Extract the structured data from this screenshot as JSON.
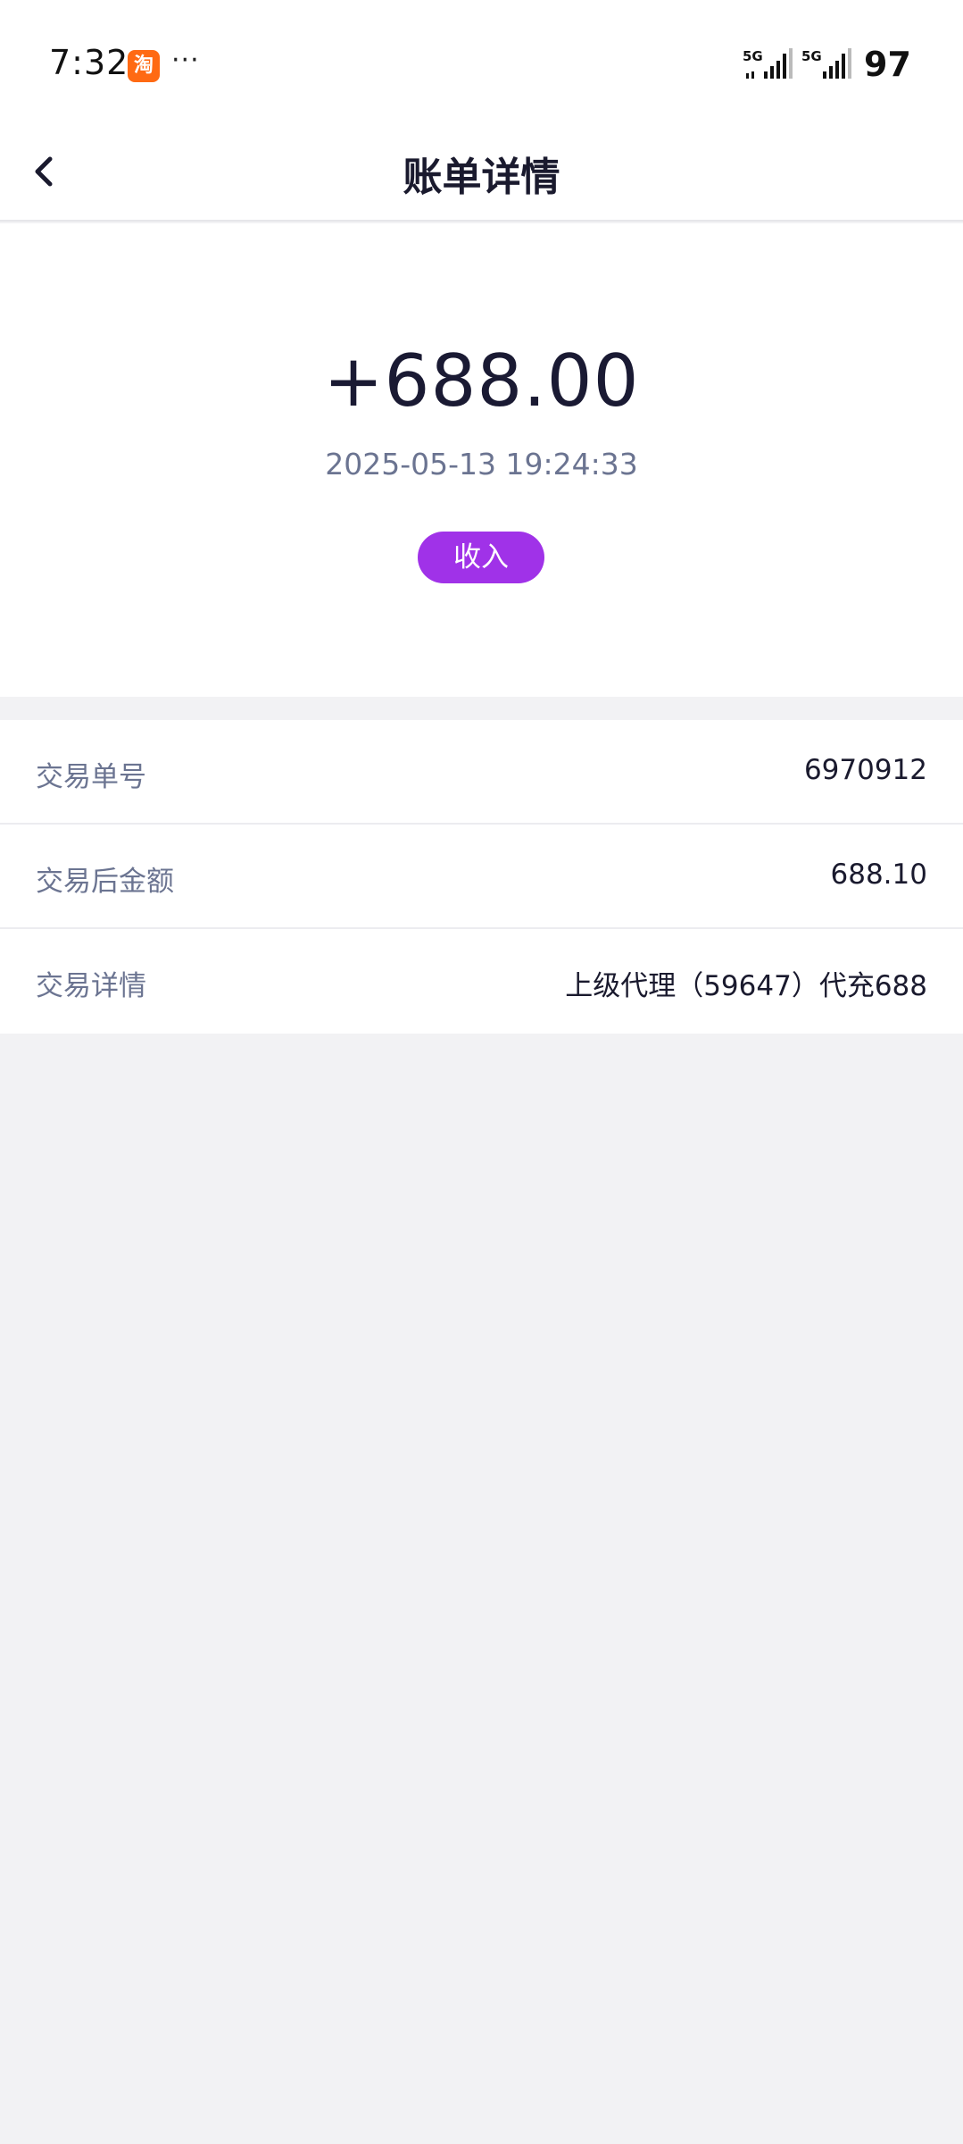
{
  "status_bar": {
    "time": "7:32",
    "app_icon_glyph": "淘",
    "more_glyph": "···",
    "network_1": "5G",
    "network_2": "5G",
    "battery": "97",
    "icons": [
      "taobao-icon",
      "signal-5g-icon",
      "signal-5g-icon"
    ]
  },
  "header": {
    "title": "账单详情",
    "back_icon": "chevron-left-icon"
  },
  "summary": {
    "amount": "+688.00",
    "datetime": "2025-05-13 19:24:33",
    "type_label": "收入"
  },
  "details": [
    {
      "label": "交易单号",
      "value": "6970912"
    },
    {
      "label": "交易后金额",
      "value": "688.10"
    },
    {
      "label": "交易详情",
      "value": "上级代理（59647）代充688"
    }
  ],
  "colors": {
    "accent": "#a032e8",
    "background": "#f2f2f4",
    "label_text": "#6b7491",
    "value_text": "#1a1a2e"
  }
}
